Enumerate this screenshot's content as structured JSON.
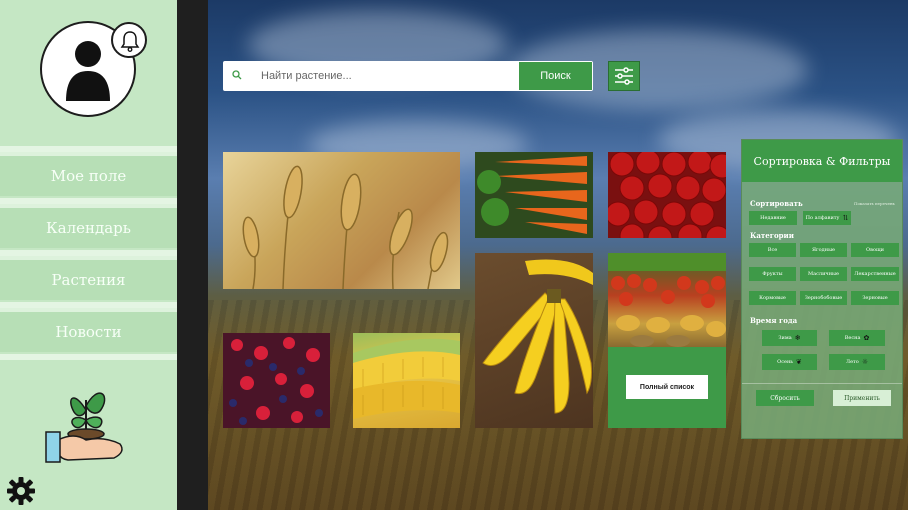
{
  "sidebar": {
    "nav": [
      {
        "label": "Мое поле"
      },
      {
        "label": "Календарь"
      },
      {
        "label": "Растения"
      },
      {
        "label": "Новости"
      }
    ]
  },
  "search": {
    "placeholder": "Найти растение...",
    "button_label": "Поиск"
  },
  "tiles": {
    "full_list_label": "Полный список"
  },
  "filters": {
    "title": "Сортировка & Фильтры",
    "sort_label": "Сортировать",
    "sort_hint": "Показать перечень",
    "sort_options": [
      "Недавние",
      "По алфавиту"
    ],
    "categories_label": "Категории",
    "categories": [
      "Все",
      "Ягодные",
      "Овощи",
      "Фрукты",
      "Масличные",
      "Лекарственные",
      "Кормовые",
      "Зернобобовые",
      "Зерновые"
    ],
    "seasons_label": "Время года",
    "seasons": [
      "Зима",
      "Весна",
      "Осень",
      "Лето"
    ],
    "reset_label": "Сбросить",
    "apply_label": "Применить"
  },
  "colors": {
    "accent": "#3e9a48",
    "sidebar": "#c5e7c4"
  }
}
